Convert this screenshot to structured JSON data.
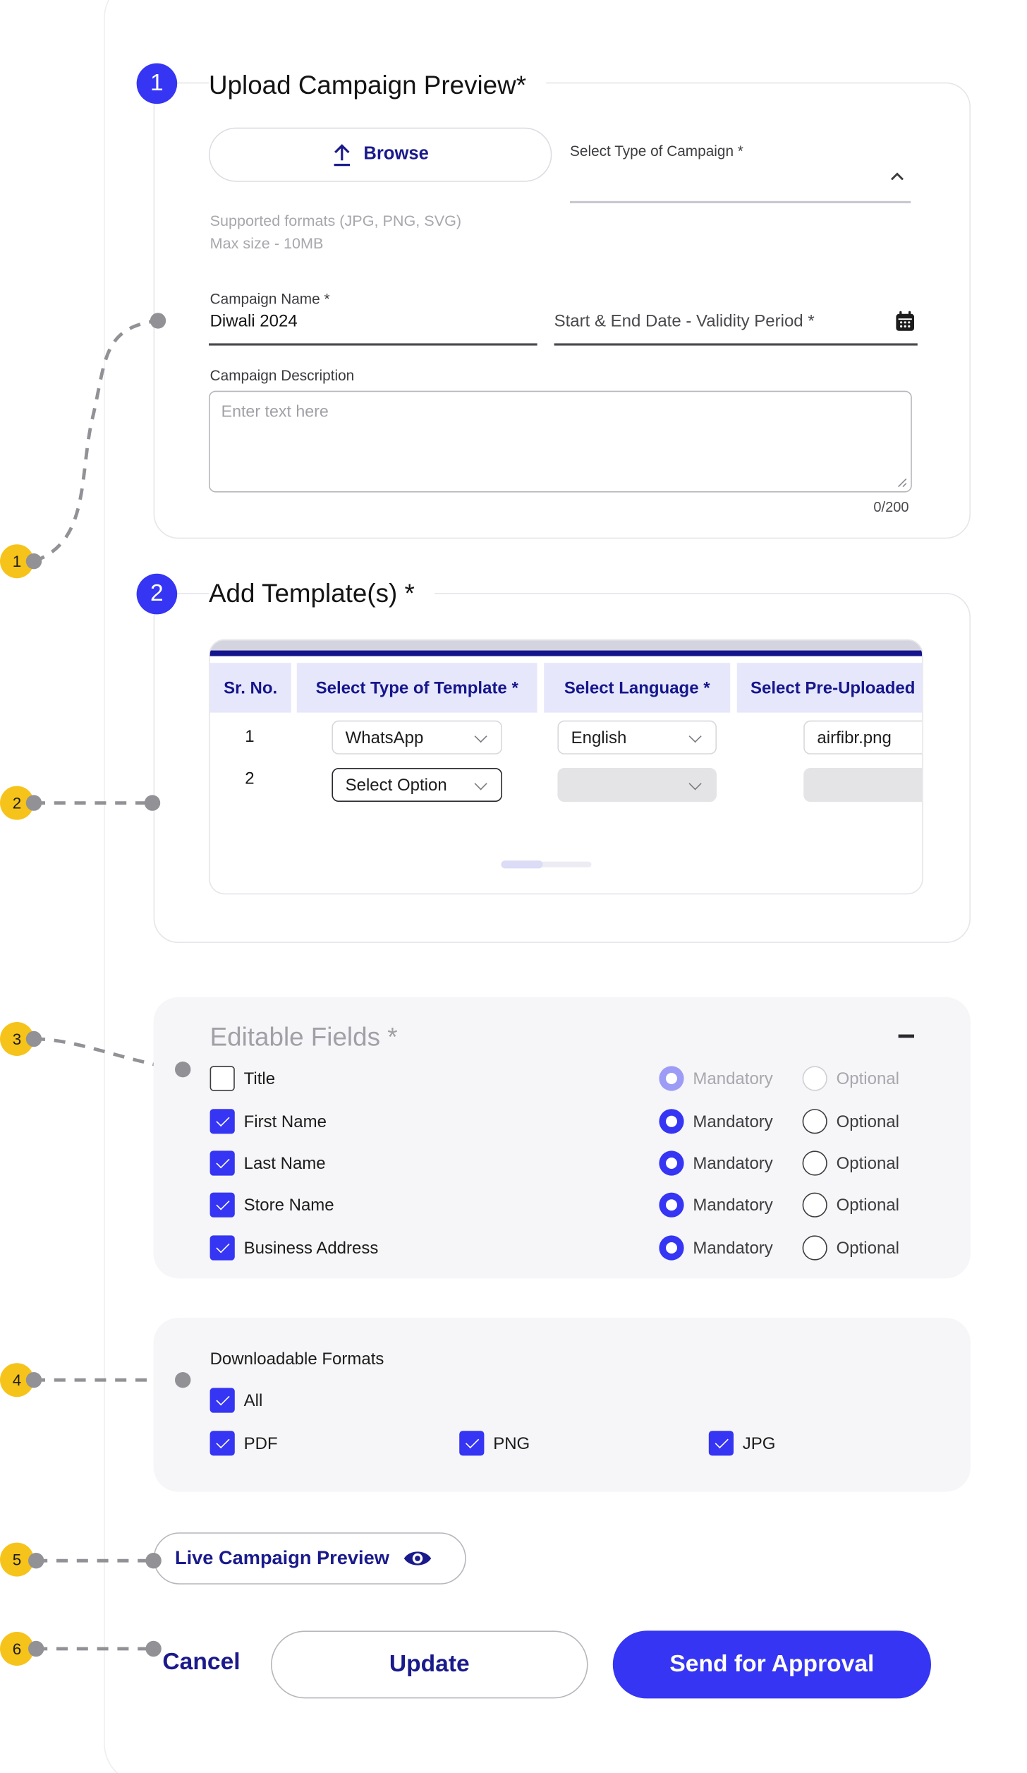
{
  "section1": {
    "step": "1",
    "title": "Upload Campaign Preview*",
    "browse_label": "Browse",
    "type_label": "Select Type of Campaign *",
    "formats_line1": "Supported formats (JPG, PNG, SVG)",
    "formats_line2": "Max size - 10MB",
    "name_label": "Campaign Name *",
    "name_value": "Diwali 2024",
    "date_placeholder": "Start & End Date - Validity Period *",
    "desc_label": "Campaign Description",
    "desc_placeholder": "Enter text here",
    "char_count": "0/200"
  },
  "section2": {
    "step": "2",
    "title": "Add Template(s) *",
    "headers": [
      "Sr. No.",
      "Select Type of Template *",
      "Select Language *",
      "Select Pre-Uploaded"
    ],
    "rows": [
      {
        "sr": "1",
        "template": "WhatsApp",
        "language": "English",
        "file": "airfibr.png"
      },
      {
        "sr": "2",
        "template": "Select Option",
        "language": "",
        "file": ""
      }
    ]
  },
  "editable": {
    "title": "Editable Fields *",
    "collapse_symbol": "–",
    "mandatory_label": "Mandatory",
    "optional_label": "Optional",
    "fields": [
      {
        "label": "Title",
        "checked": false,
        "choice": "mandatory",
        "disabled": true
      },
      {
        "label": "First Name",
        "checked": true,
        "choice": "mandatory",
        "disabled": false
      },
      {
        "label": "Last Name",
        "checked": true,
        "choice": "mandatory",
        "disabled": false
      },
      {
        "label": "Store Name",
        "checked": true,
        "choice": "mandatory",
        "disabled": false
      },
      {
        "label": "Business Address",
        "checked": true,
        "choice": "mandatory",
        "disabled": false
      }
    ]
  },
  "downloadable": {
    "title": "Downloadable Formats",
    "all_label": "All",
    "formats": [
      "PDF",
      "PNG",
      "JPG"
    ]
  },
  "actions": {
    "live_preview": "Live Campaign Preview",
    "cancel": "Cancel",
    "update": "Update",
    "send": "Send for Approval"
  },
  "annotations": [
    "1",
    "2",
    "3",
    "4",
    "5",
    "6"
  ],
  "colors": {
    "primary": "#3535f3",
    "navy": "#1a1a8c",
    "annotation": "#f6c31a",
    "header_bg": "#e6e7fb"
  }
}
